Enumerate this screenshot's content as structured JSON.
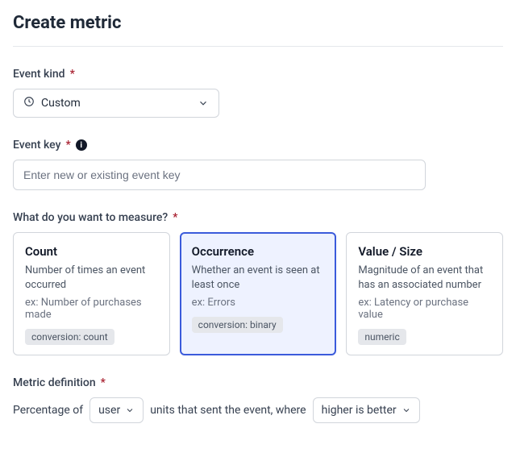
{
  "title": "Create metric",
  "eventKind": {
    "label": "Event kind",
    "required": "*",
    "value": "Custom"
  },
  "eventKey": {
    "label": "Event key",
    "required": "*",
    "placeholder": "Enter new or existing event key"
  },
  "measure": {
    "label": "What do you want to measure?",
    "required": "*",
    "options": [
      {
        "title": "Count",
        "desc": "Number of times an event occurred",
        "example": "ex: Number of purchases made",
        "tag": "conversion: count",
        "selected": false
      },
      {
        "title": "Occurrence",
        "desc": "Whether an event is seen at least once",
        "example": "ex: Errors",
        "tag": "conversion: binary",
        "selected": true
      },
      {
        "title": "Value / Size",
        "desc": "Magnitude of an event that has an associated number",
        "example": "ex: Latency or purchase value",
        "tag": "numeric",
        "selected": false
      }
    ]
  },
  "definition": {
    "label": "Metric definition",
    "required": "*",
    "prefix": "Percentage of",
    "unitSelect": "user",
    "middle": "units that sent the event, where",
    "directionSelect": "higher is better"
  }
}
